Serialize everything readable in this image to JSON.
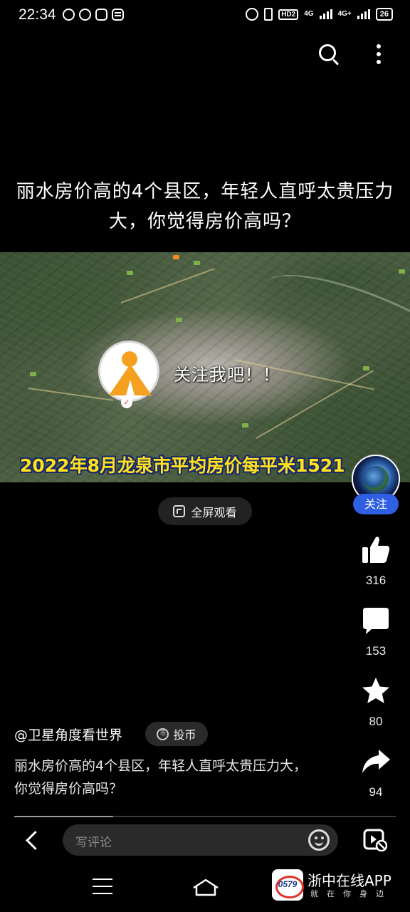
{
  "status_bar": {
    "time": "22:34",
    "network_label": "4G",
    "network2_label": "4G+",
    "hd_label": "HD2",
    "battery": "26"
  },
  "video": {
    "title": "丽水房价高的4个县区，年轻人直呼太贵压力大，你觉得房价高吗？",
    "overlay_follow_text": "关注我吧！！",
    "caption": "2022年8月龙泉市平均房价每平米1521"
  },
  "fullscreen": {
    "label": "全屏观看"
  },
  "author": {
    "name": "@卫星角度看世界",
    "follow_label": "关注",
    "coin_label": "投币",
    "coin_icon_text": "币"
  },
  "actions": {
    "likes": "316",
    "comments": "153",
    "favorites": "80",
    "shares": "94"
  },
  "description": "丽水房价高的4个县区，年轻人直呼太贵压力大，你觉得房价高吗？",
  "playback": {
    "progress_fraction": 0.26
  },
  "comment_bar": {
    "placeholder": "写评论"
  },
  "watermark": {
    "logo_text": "0579",
    "title": "浙中在线APP",
    "subtitle": "就在你身边"
  },
  "icons": {
    "search": "search-icon",
    "more": "more-vertical-icon",
    "like": "thumbs-up-icon",
    "comment": "comment-bubble-icon",
    "favorite": "star-icon",
    "share": "share-arrow-icon",
    "back": "chevron-left-icon",
    "emoji": "emoji-icon",
    "pip": "video-pip-icon"
  },
  "colors": {
    "accent_blue": "#2f5fe3",
    "caption_yellow": "#ffe21a",
    "brand_orange": "#f5a01e"
  }
}
